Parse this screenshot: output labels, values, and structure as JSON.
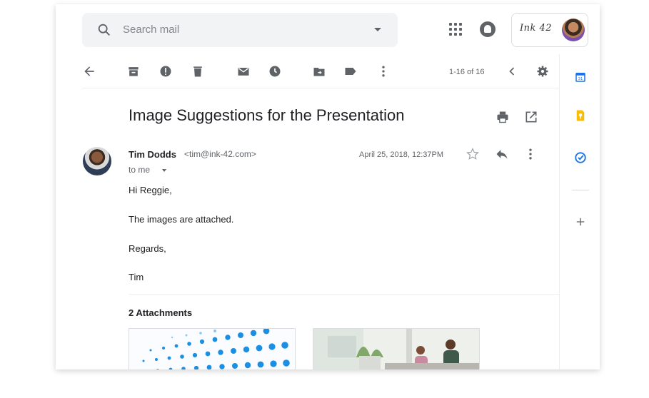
{
  "search": {
    "placeholder": "Search mail"
  },
  "account": {
    "logo_text": "Ink 42"
  },
  "toolbar": {
    "back": "arrow-back-icon",
    "archive": "archive-icon",
    "spam": "report-spam-icon",
    "delete": "delete-icon",
    "mark_unread": "mark-unread-icon",
    "snooze": "snooze-icon",
    "move_to": "move-to-icon",
    "labels": "label-icon",
    "more": "more-vert-icon",
    "pager": "1-16 of 16",
    "settings": "settings-icon"
  },
  "email": {
    "subject": "Image Suggestions for the Presentation",
    "sender_name": "Tim Dodds",
    "sender_email": "<tim@ink-42.com>",
    "recipient": "to me",
    "date": "April 25, 2018, 12:37PM",
    "body": [
      "Hi Reggie,",
      "The images are attached.",
      "Regards,",
      "Tim"
    ],
    "attachments_title": "2 Attachments"
  },
  "side_panel": [
    "calendar-icon",
    "keep-icon",
    "tasks-icon",
    "add-icon"
  ],
  "colors": {
    "calendar": "#1a73e8",
    "keep": "#fbbc04",
    "tasks": "#1a73e8",
    "icon": "#5f6368"
  }
}
